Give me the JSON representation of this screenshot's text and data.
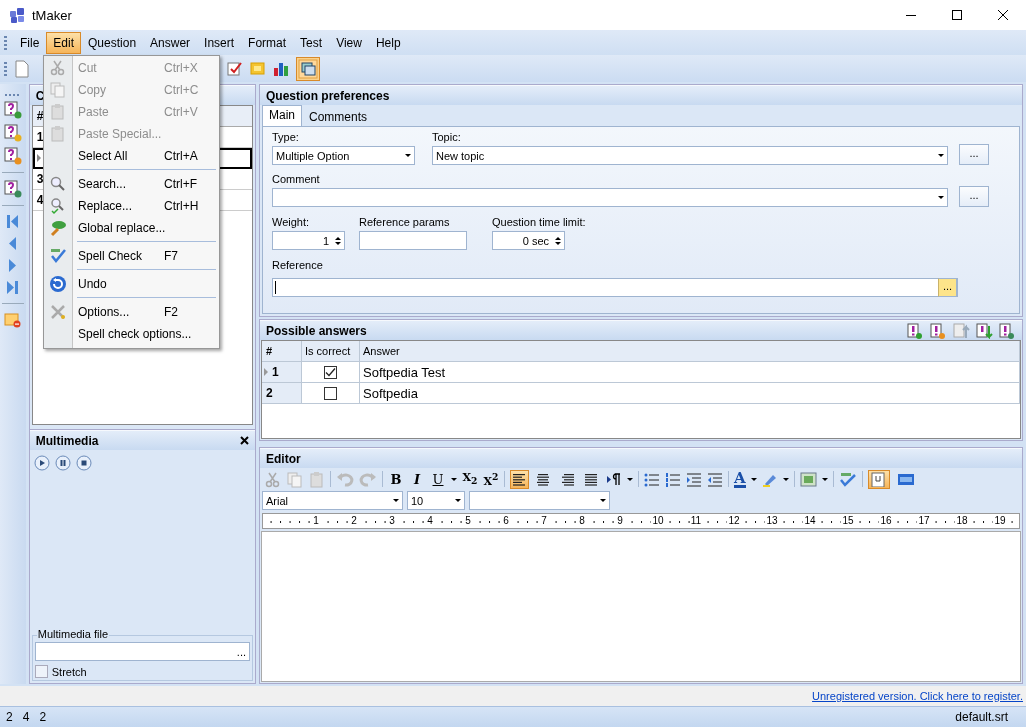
{
  "window": {
    "title": "tMaker"
  },
  "menu_bar": [
    {
      "label": "File",
      "selected": false
    },
    {
      "label": "Edit",
      "selected": true
    },
    {
      "label": "Question",
      "selected": false
    },
    {
      "label": "Answer",
      "selected": false
    },
    {
      "label": "Insert",
      "selected": false
    },
    {
      "label": "Format",
      "selected": false
    },
    {
      "label": "Test",
      "selected": false
    },
    {
      "label": "View",
      "selected": false
    },
    {
      "label": "Help",
      "selected": false
    }
  ],
  "edit_menu": [
    {
      "kind": "item",
      "label": "Cut",
      "shortcut": "Ctrl+X",
      "disabled": true
    },
    {
      "kind": "item",
      "label": "Copy",
      "shortcut": "Ctrl+C",
      "disabled": true
    },
    {
      "kind": "item",
      "label": "Paste",
      "shortcut": "Ctrl+V",
      "disabled": true
    },
    {
      "kind": "item",
      "label": "Paste Special...",
      "disabled": true
    },
    {
      "kind": "item",
      "label": "Select All",
      "shortcut": "Ctrl+A",
      "disabled": false
    },
    {
      "kind": "separator"
    },
    {
      "kind": "item",
      "label": "Search...",
      "shortcut": "Ctrl+F",
      "disabled": false
    },
    {
      "kind": "item",
      "label": "Replace...",
      "shortcut": "Ctrl+H",
      "disabled": false
    },
    {
      "kind": "item",
      "label": "Global replace...",
      "disabled": false
    },
    {
      "kind": "separator"
    },
    {
      "kind": "item",
      "label": "Spell Check",
      "shortcut": "F7",
      "disabled": false
    },
    {
      "kind": "separator"
    },
    {
      "kind": "item",
      "label": "Undo",
      "disabled": false
    },
    {
      "kind": "separator"
    },
    {
      "kind": "item",
      "label": "Options...",
      "shortcut": "F2",
      "disabled": false
    },
    {
      "kind": "item",
      "label": "Spell check options...",
      "disabled": false
    }
  ],
  "questions_panel": {
    "title": "C",
    "column": "#",
    "rows": [
      {
        "number": "1",
        "selected": false
      },
      {
        "selected": true
      },
      {
        "number": "3",
        "selected": false
      },
      {
        "number": "4",
        "selected": false
      }
    ]
  },
  "multimedia": {
    "title": "Multimedia",
    "file_label": "Multimedia file",
    "file_button": "...",
    "stretch": {
      "label": "Stretch",
      "checked": false
    }
  },
  "question_preferences": {
    "title": "Question preferences",
    "tabs": [
      {
        "label": "Main",
        "selected": true
      },
      {
        "label": "Comments",
        "selected": false
      }
    ],
    "type": {
      "label": "Type:",
      "value": "Multiple Option"
    },
    "topic": {
      "label": "Topic:",
      "value": "New topic",
      "button": "..."
    },
    "comment": {
      "label": "Comment",
      "button": "..."
    },
    "weight": {
      "label": "Weight:",
      "value": "1"
    },
    "reference_params": {
      "label": "Reference params"
    },
    "time_limit": {
      "label": "Question time limit:",
      "value": "0 sec"
    },
    "reference": {
      "label": "Reference",
      "button": "..."
    }
  },
  "possible_answers": {
    "title": "Possible answers",
    "columns": [
      "#",
      "Is correct",
      "Answer"
    ],
    "rows": [
      {
        "number": "1",
        "correct": true,
        "answer": "Softpedia Test",
        "selected": true
      },
      {
        "number": "2",
        "correct": false,
        "answer": "Softpedia",
        "selected": false
      }
    ]
  },
  "editor": {
    "title": "Editor",
    "format_buttons": [
      "B",
      "I",
      "U",
      "X$_{2}$",
      "X$^{2}$"
    ],
    "alignment": [
      {
        "selected": true
      },
      {
        "selected": false
      },
      {
        "selected": false
      },
      {
        "selected": false
      }
    ],
    "font_color_button": "A",
    "view_modes": [
      {
        "selected": true
      },
      {
        "selected": false
      }
    ],
    "font": "Arial",
    "size": "10",
    "ruler": [
      "1",
      "2",
      "3",
      "4",
      "5",
      "6",
      "7",
      "8",
      "9",
      "10",
      "11",
      "12",
      "13",
      "14",
      "15",
      "16",
      "17",
      "18",
      "19"
    ]
  },
  "register_link": "Unregistered version. Click here to register.",
  "status_bar": {
    "counts": [
      "2",
      "4",
      "2"
    ],
    "file": "default.srt"
  }
}
